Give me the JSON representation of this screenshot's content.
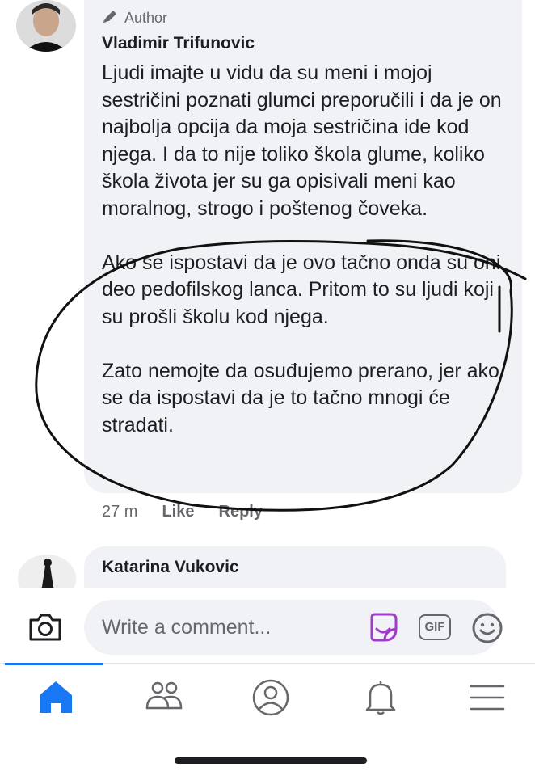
{
  "comment": {
    "author_badge": "Author",
    "author_name": "Vladimir Trifunovic",
    "paragraphs": [
      "Ljudi imajte u vidu da su meni i mojoj sestričini poznati glumci preporučili i da je on najbolja opcija da moja sestričina ide kod njega. I da to nije toliko škola glume, koliko škola života jer su ga opisivali meni kao moralnog, strogo i poštenog čoveka.",
      "Ako se ispostavi da je ovo tačno onda su oni deo pedofilskog lanca. Pritom to su ljudi koji su prošli školu kod njega.",
      "Zato nemojte da osuđujemo prerano, jer ako se da ispostavi da je to tačno mnogi će stradati."
    ],
    "time": "27 m",
    "like_label": "Like",
    "reply_label": "Reply"
  },
  "next_comment": {
    "author_name": "Katarina Vukovic"
  },
  "composer": {
    "placeholder": "Write a comment...",
    "gif_label": "GIF"
  },
  "icons": {
    "author": "pencil-icon",
    "camera": "camera-icon",
    "sticker": "sticker-icon",
    "gif": "gif-icon",
    "emoji": "emoji-icon",
    "home": "home-icon",
    "friends": "friends-icon",
    "profile": "profile-icon",
    "notifications": "bell-icon",
    "menu": "menu-icon"
  },
  "colors": {
    "accent": "#1877f2",
    "bubble": "#f0f2f5",
    "secondary_text": "#65676b",
    "sticker": "#a03cc8"
  }
}
